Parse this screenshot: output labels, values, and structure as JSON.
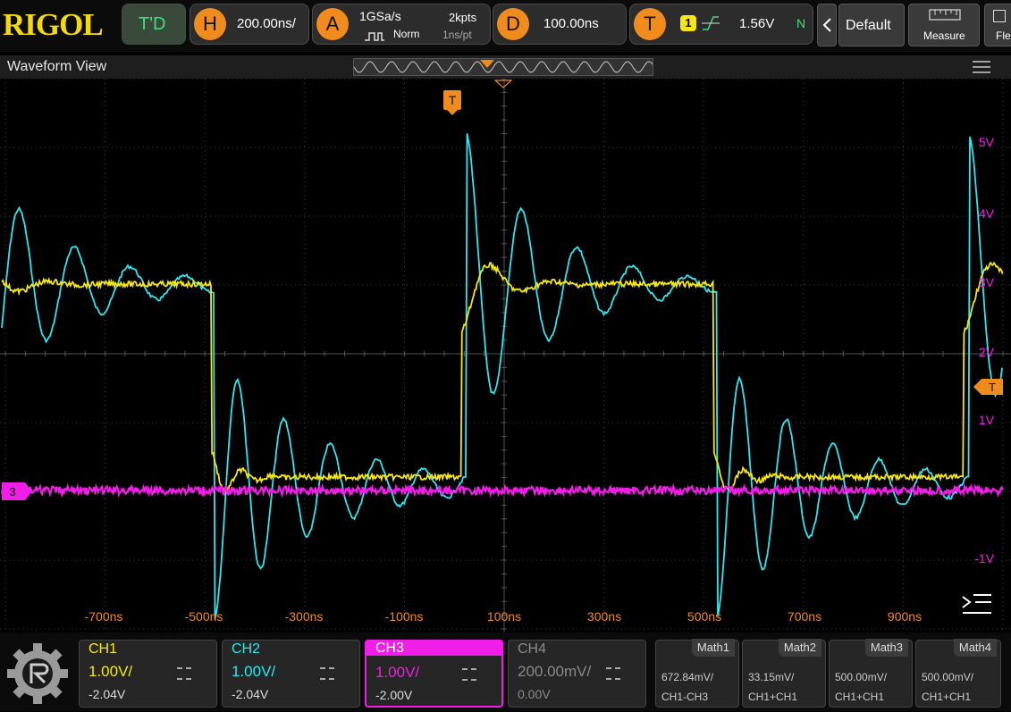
{
  "brand": "RIGOL",
  "topbar": {
    "td_label": "T'D",
    "horizontal": {
      "letter": "H",
      "value": "200.00ns/"
    },
    "acquire": {
      "letter": "A",
      "rate": "1GSa/s",
      "points": "2kpts",
      "mode": "Norm",
      "sample_interval": "1ns/pt"
    },
    "delay": {
      "letter": "D",
      "value": "100.00ns"
    },
    "trigger": {
      "letter": "T",
      "source": "1",
      "level": "1.56V",
      "status": "N"
    },
    "back_icon": "chevron-left-icon",
    "default_label": "Default",
    "measure_label": "Measure",
    "next_label": "Fle"
  },
  "view": {
    "title": "Waveform View",
    "trigger_marker": "T",
    "right_trigger_marker": "T"
  },
  "axes": {
    "x_ticks": [
      "-700ns",
      "-500ns",
      "-300ns",
      "-100ns",
      "100ns",
      "300ns",
      "500ns",
      "700ns",
      "900ns"
    ],
    "y_ticks": [
      "5V",
      "4V",
      "3V",
      "2V",
      "1V",
      "-1V"
    ],
    "ch3_marker": "3"
  },
  "channels": [
    {
      "name": "CH1",
      "scale": "1.00V/",
      "offset": "-2.04V",
      "color": "#f5e614"
    },
    {
      "name": "CH2",
      "scale": "1.00V/",
      "offset": "-2.04V",
      "color": "#2ee6f0"
    },
    {
      "name": "CH3",
      "scale": "1.00V/",
      "offset": "-2.00V",
      "color": "#f01ee6"
    },
    {
      "name": "CH4",
      "scale": "200.00mV/",
      "offset": "0.00V",
      "color": "#8a8a8a"
    }
  ],
  "math": [
    {
      "name": "Math1",
      "value": "672.84mV/",
      "source": "CH1-CH3"
    },
    {
      "name": "Math2",
      "value": "33.15mV/",
      "source": "CH1+CH1"
    },
    {
      "name": "Math3",
      "value": "500.00mV/",
      "source": "CH1+CH1"
    },
    {
      "name": "Math4",
      "value": "500.00mV/",
      "source": "CH1+CH1"
    }
  ]
}
